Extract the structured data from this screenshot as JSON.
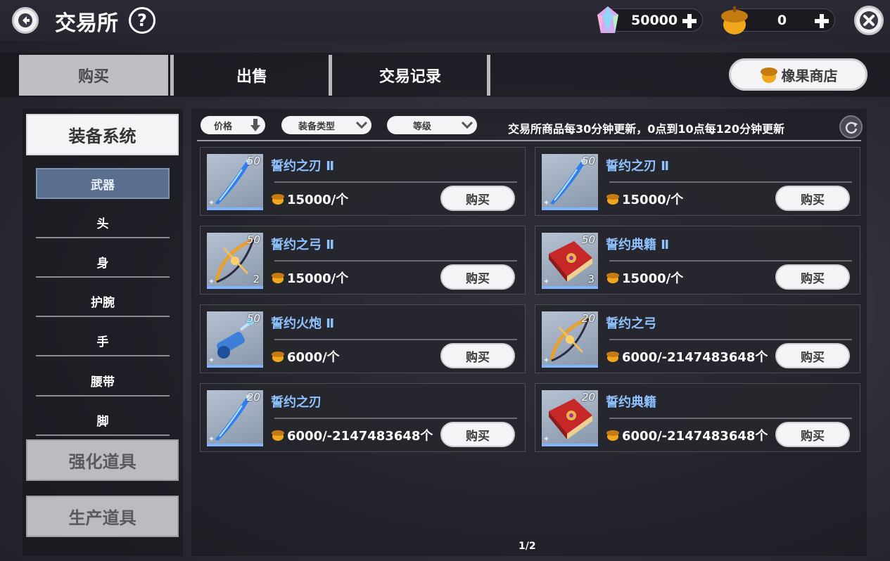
{
  "header": {
    "title": "交易所",
    "help": "?",
    "gems": "50000",
    "acorns": "0"
  },
  "tabs": [
    {
      "label": "购买"
    },
    {
      "label": "出售"
    },
    {
      "label": "交易记录"
    }
  ],
  "acorn_shop_label": "橡果商店",
  "sidebar": {
    "main_category": "装备系统",
    "sub_items": [
      {
        "label": "武器"
      },
      {
        "label": "头"
      },
      {
        "label": "身"
      },
      {
        "label": "护腕"
      },
      {
        "label": "手"
      },
      {
        "label": "腰带"
      },
      {
        "label": "脚"
      }
    ],
    "other_categories": [
      {
        "label": "强化道具"
      },
      {
        "label": "生产道具"
      }
    ]
  },
  "filters": [
    {
      "label": "价格"
    },
    {
      "label": "装备类型"
    },
    {
      "label": "等级"
    }
  ],
  "notice": "交易所商品每30分钟更新，0点到10点每120分钟更新",
  "items": [
    {
      "name": "誓约之刃 Ⅱ",
      "level": "50",
      "count": "",
      "price": "15000/个",
      "buy": "购买",
      "kind": "blade"
    },
    {
      "name": "誓约之刃 Ⅱ",
      "level": "50",
      "count": "",
      "price": "15000/个",
      "buy": "购买",
      "kind": "blade"
    },
    {
      "name": "誓约之弓 Ⅱ",
      "level": "50",
      "count": "2",
      "price": "15000/个",
      "buy": "购买",
      "kind": "bow"
    },
    {
      "name": "誓约典籍 Ⅱ",
      "level": "50",
      "count": "3",
      "price": "15000/个",
      "buy": "购买",
      "kind": "book"
    },
    {
      "name": "誓约火炮 Ⅱ",
      "level": "50",
      "count": "",
      "price": "6000/个",
      "buy": "购买",
      "kind": "cannon"
    },
    {
      "name": "誓约之弓",
      "level": "20",
      "count": "",
      "price": "6000/-2147483648个",
      "buy": "购买",
      "kind": "bow"
    },
    {
      "name": "誓约之刃",
      "level": "20",
      "count": "",
      "price": "6000/-2147483648个",
      "buy": "购买",
      "kind": "blade"
    },
    {
      "name": "誓约典籍",
      "level": "20",
      "count": "",
      "price": "6000/-2147483648个",
      "buy": "购买",
      "kind": "book"
    }
  ],
  "pager": "1/2"
}
